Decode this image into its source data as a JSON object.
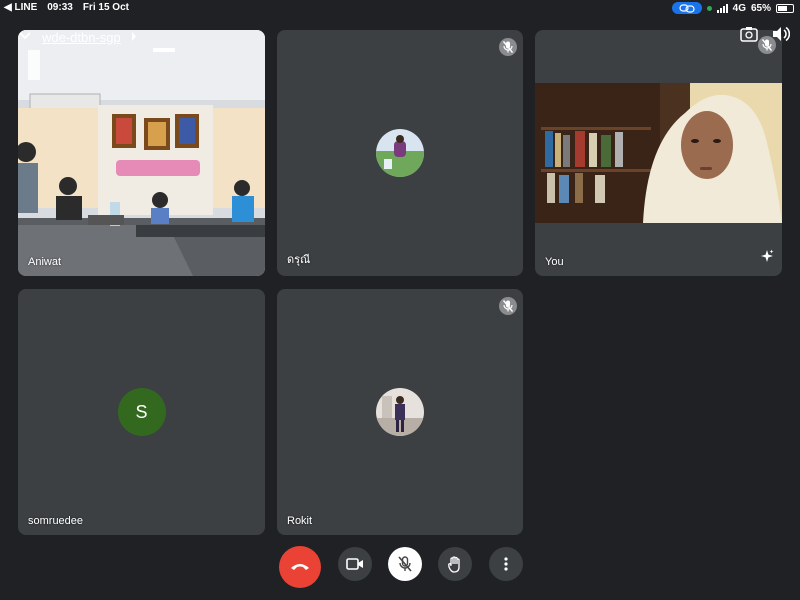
{
  "status_bar": {
    "back_app": "◀ LINE",
    "time": "09:33",
    "date": "Fri 15 Oct",
    "network": "4G",
    "battery": "65%",
    "battery_level": 0.65
  },
  "meeting": {
    "code": "wde-dtbn-sgp"
  },
  "tiles": {
    "aniwat": {
      "name": "Aniwat"
    },
    "darunee": {
      "name": "ดรุณี"
    },
    "you": {
      "name": "You"
    },
    "somruedee": {
      "name": "somruedee",
      "initial": "S",
      "avatar_color": "#33691e"
    },
    "rokit": {
      "name": "Rokit"
    }
  },
  "colors": {
    "background": "#202124",
    "tile": "#3c4043",
    "end_call": "#ea4335",
    "accent": "#1a73e8"
  },
  "icons": {
    "chevron": "chevron-down-icon",
    "camera_switch": "switch-camera-icon",
    "speaker": "speaker-icon",
    "end_call": "phone-end-icon",
    "camera": "video-camera-icon",
    "mic": "mic-off-icon",
    "hand": "raise-hand-icon",
    "more": "more-vert-icon",
    "effects": "sparkle-icon"
  }
}
